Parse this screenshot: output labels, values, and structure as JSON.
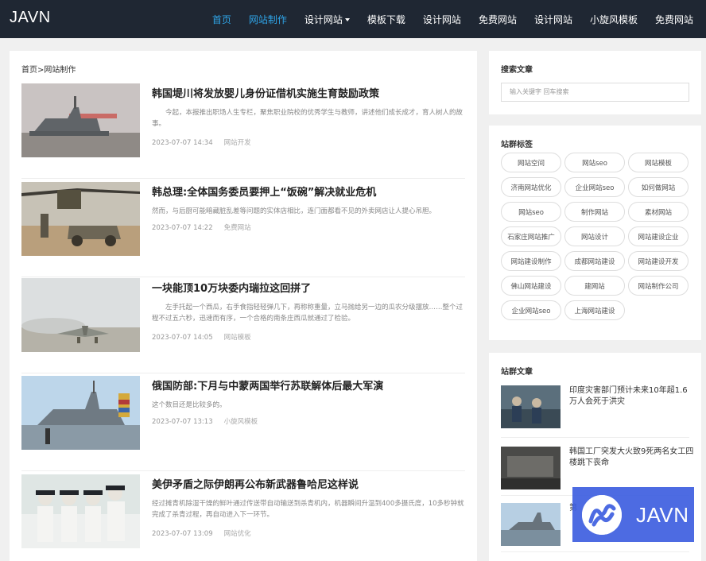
{
  "header": {
    "logo": "JAVN",
    "nav": [
      {
        "label": "首页",
        "active": true
      },
      {
        "label": "网站制作",
        "active": true
      },
      {
        "label": "设计网站",
        "dropdown": true
      },
      {
        "label": "模板下载"
      },
      {
        "label": "设计网站"
      },
      {
        "label": "免费网站"
      },
      {
        "label": "设计网站"
      },
      {
        "label": "小旋风模板"
      },
      {
        "label": "免费网站"
      }
    ]
  },
  "breadcrumb": "首页>网站制作",
  "articles": [
    {
      "title": "韩国堤川将发放婴儿身份证借机实施生育鼓励政策",
      "desc": "今起，本报推出职场人生专栏，聚焦职业院校的优秀学生与教师，讲述他们成长成才，育人树人的故事。",
      "date": "2023-07-07 14:34",
      "category": "网站开发"
    },
    {
      "title": "韩总理:全体国务委员要押上“饭碗”解决就业危机",
      "desc": "然而，与后厨可能暗藏脏乱差等问题的实体店相比，连门面都看不见的外卖网店让人提心吊胆。",
      "date": "2023-07-07 14:22",
      "category": "免费网站"
    },
    {
      "title": "一块能顶10万块委内瑞拉这回拼了",
      "desc": "左手托起一个西瓜，右手食指轻轻弹几下，再称称重量，立马抛给另一边的瓜农分级摆放……整个过程不过五六秒，迅速而有序，一个合格的南条庄西瓜就通过了检验。",
      "date": "2023-07-07 14:05",
      "category": "网站模板"
    },
    {
      "title": "俄国防部:下月与中蒙两国举行苏联解体后最大军演",
      "desc": "这个数目还是比较多的。",
      "date": "2023-07-07 13:13",
      "category": "小旋风模板"
    },
    {
      "title": "美伊矛盾之际伊朗再公布新武器鲁哈尼这样说",
      "desc": "经过摊青机除湿干燥的鲜叶通过传送带自动输送到杀青机内，机器瞬间升温到400多摄氏度，10多秒钟就完成了杀青过程，再自动进入下一环节。",
      "date": "2023-07-07 13:09",
      "category": "网站优化"
    }
  ],
  "sidebar": {
    "search": {
      "title": "搜索文章",
      "placeholder": "输入关键字 回车搜索"
    },
    "tags": {
      "title": "站群标签",
      "items": [
        "网站空间",
        "网站seo",
        "网站模板",
        "济南网站优化",
        "企业网站seo",
        "如何做网站",
        "网站seo",
        "制作网站",
        "素材网站",
        "石家庄网站推广",
        "网站设计",
        "网站建设企业",
        "网站建设制作",
        "成都网站建设",
        "网站建设开发",
        "佛山网站建设",
        "建网站",
        "网站制作公司",
        "企业网站seo",
        "上海网站建设"
      ]
    },
    "related": {
      "title": "站群文章",
      "items": [
        {
          "title": "印度灾害部门预计未来10年超1.6万人会死于洪灾"
        },
        {
          "title": "韩国工厂突发大火致9死两名女工四楼跳下丧命"
        },
        {
          "title": "第"
        }
      ]
    }
  },
  "badge": {
    "text": "JAVN"
  },
  "colors": {
    "header_bg": "#1f2733",
    "accent": "#2fa4e7",
    "badge_bg": "#3e5fe0"
  }
}
